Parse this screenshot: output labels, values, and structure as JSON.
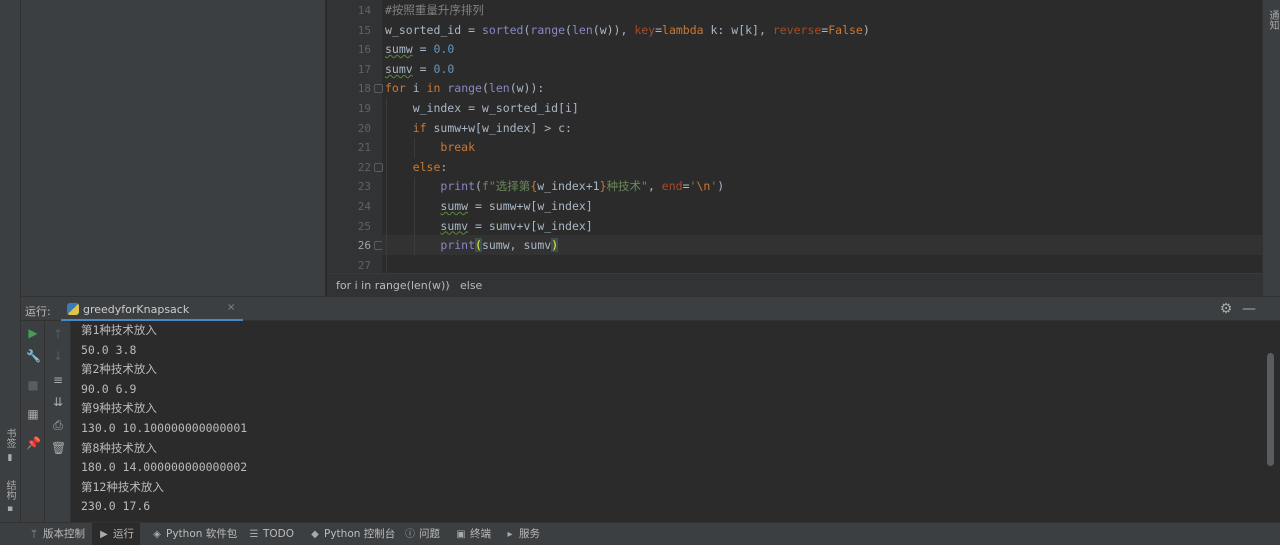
{
  "left_stripe": {
    "items": [
      {
        "label": "书签",
        "icon": "bookmark-icon"
      },
      {
        "label": "结构",
        "icon": "structure-icon"
      }
    ]
  },
  "right_stripe": {
    "label": "通知"
  },
  "editor": {
    "line_numbers": [
      "14",
      "15",
      "16",
      "17",
      "18",
      "19",
      "20",
      "21",
      "22",
      "23",
      "24",
      "25",
      "26",
      "27"
    ],
    "lines": [
      {
        "tokens": [
          {
            "t": "#按照重量升序排列",
            "c": "c"
          }
        ]
      },
      {
        "tokens": [
          {
            "t": "w_sorted_id = "
          },
          {
            "t": "sorted",
            "c": "f"
          },
          {
            "t": "("
          },
          {
            "t": "range",
            "c": "f"
          },
          {
            "t": "("
          },
          {
            "t": "len",
            "c": "f"
          },
          {
            "t": "(w)), "
          },
          {
            "t": "key",
            "c": "p"
          },
          {
            "t": "="
          },
          {
            "t": "lambda",
            "c": "k"
          },
          {
            "t": " k: w[k], "
          },
          {
            "t": "reverse",
            "c": "p"
          },
          {
            "t": "="
          },
          {
            "t": "False",
            "c": "k"
          },
          {
            "t": ")"
          }
        ]
      },
      {
        "tokens": [
          {
            "t": "sumw",
            "c": "sv"
          },
          {
            "t": " = "
          },
          {
            "t": "0.0",
            "c": "n"
          }
        ]
      },
      {
        "tokens": [
          {
            "t": "sumv",
            "c": "sv"
          },
          {
            "t": " = "
          },
          {
            "t": "0.0",
            "c": "n"
          }
        ]
      },
      {
        "tokens": [
          {
            "t": "for",
            "c": "k"
          },
          {
            "t": " i "
          },
          {
            "t": "in",
            "c": "k"
          },
          {
            "t": " "
          },
          {
            "t": "range",
            "c": "f"
          },
          {
            "t": "("
          },
          {
            "t": "len",
            "c": "f"
          },
          {
            "t": "(w)):"
          }
        ]
      },
      {
        "tokens": [
          {
            "t": "    w_index = w_sorted_id[i]"
          }
        ]
      },
      {
        "tokens": [
          {
            "t": "    "
          },
          {
            "t": "if",
            "c": "k"
          },
          {
            "t": " sumw+w[w_index] > c:"
          }
        ]
      },
      {
        "tokens": [
          {
            "t": "        "
          },
          {
            "t": "break",
            "c": "k"
          }
        ]
      },
      {
        "tokens": [
          {
            "t": "    "
          },
          {
            "t": "else",
            "c": "k"
          },
          {
            "t": ":"
          }
        ]
      },
      {
        "tokens": [
          {
            "t": "        "
          },
          {
            "t": "print",
            "c": "f"
          },
          {
            "t": "("
          },
          {
            "t": "f\"选择第",
            "c": "s"
          },
          {
            "t": "{",
            "c": "fs"
          },
          {
            "t": "w_index+1"
          },
          {
            "t": "}",
            "c": "fs"
          },
          {
            "t": "种技术\"",
            "c": "s"
          },
          {
            "t": ", "
          },
          {
            "t": "end",
            "c": "p"
          },
          {
            "t": "="
          },
          {
            "t": "'",
            "c": "s"
          },
          {
            "t": "\\n",
            "c": "k"
          },
          {
            "t": "'",
            "c": "s"
          },
          {
            "t": ")"
          }
        ]
      },
      {
        "tokens": [
          {
            "t": "        "
          },
          {
            "t": "sumw",
            "c": "sv"
          },
          {
            "t": " = sumw+w[w_index]"
          }
        ]
      },
      {
        "tokens": [
          {
            "t": "        "
          },
          {
            "t": "sumv",
            "c": "sv"
          },
          {
            "t": " = sumv+v[w_index]"
          }
        ]
      },
      {
        "tokens": [
          {
            "t": "        "
          },
          {
            "t": "print",
            "c": "f"
          },
          {
            "t": "(",
            "c": "hl-paren"
          },
          {
            "t": "sumw, sumv"
          },
          {
            "t": ")",
            "c": "hl-paren"
          }
        ]
      },
      {
        "tokens": []
      }
    ],
    "current_line": "26"
  },
  "breadcrumb": {
    "items": [
      "for i in range(len(w))",
      "else"
    ],
    "separator": "›"
  },
  "run_panel": {
    "title": "运行:",
    "tab_label": "greedyforKnapsack",
    "tab_close": "×",
    "console_lines": [
      "第1种技术放入",
      "50.0 3.8",
      "第2种技术放入",
      "90.0 6.9",
      "第9种技术放入",
      "130.0 10.100000000000001",
      "第8种技术放入",
      "180.0 14.000000000000002",
      "第12种技术放入",
      "230.0 17.6"
    ]
  },
  "statusbar": {
    "items": [
      {
        "label": "版本控制",
        "icon": "git-branch-icon"
      },
      {
        "label": "运行",
        "icon": "run-icon"
      },
      {
        "label": "Python 软件包",
        "icon": "packages-icon"
      },
      {
        "label": "TODO",
        "icon": "todo-list-icon"
      },
      {
        "label": "Python 控制台",
        "icon": "python-console-icon"
      },
      {
        "label": "问题",
        "icon": "problems-icon"
      },
      {
        "label": "终端",
        "icon": "terminal-icon"
      },
      {
        "label": "服务",
        "icon": "services-icon"
      }
    ]
  },
  "colors": {
    "background": "#2b2b2b",
    "panel": "#3c3f41",
    "keyword": "#cc7832",
    "builtin": "#8888c6",
    "number": "#6897bb",
    "string": "#6a8759",
    "comment": "#808080",
    "param": "#aa4926",
    "run_green": "#499c54",
    "tab_underline": "#4a88c7"
  }
}
